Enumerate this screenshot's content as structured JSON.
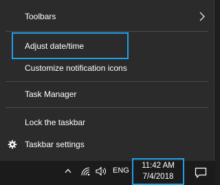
{
  "context_menu": {
    "items": [
      {
        "label": "Toolbars",
        "has_submenu": true
      },
      {
        "label": "Adjust date/time"
      },
      {
        "label": "Customize notification icons"
      },
      {
        "label": "Task Manager"
      },
      {
        "label": "Lock the taskbar"
      },
      {
        "label": "Taskbar settings",
        "icon": "gear-icon"
      }
    ]
  },
  "taskbar": {
    "language": "ENG",
    "time": "11:42 AM",
    "date": "7/4/2018",
    "tray_icons": [
      "chevron-up-icon",
      "wifi-icon",
      "speaker-icon"
    ],
    "notification_icon": "action-center-icon"
  },
  "colors": {
    "menu_background": "#2b2b2b",
    "taskbar_background": "#1b1b1b",
    "highlight_border": "#1fa0ea",
    "text": "#ffffff"
  }
}
